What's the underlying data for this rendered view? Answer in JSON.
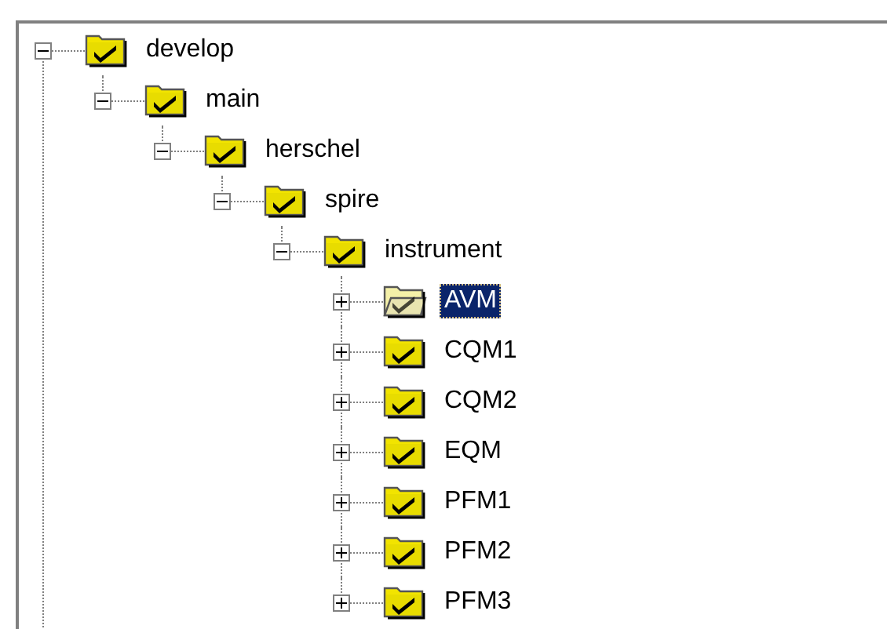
{
  "tree": [
    {
      "label": "develop",
      "expanded": true,
      "selected": false,
      "children": [
        {
          "label": "main",
          "expanded": true,
          "selected": false,
          "children": [
            {
              "label": "herschel",
              "expanded": true,
              "selected": false,
              "children": [
                {
                  "label": "spire",
                  "expanded": true,
                  "selected": false,
                  "children": [
                    {
                      "label": "instrument",
                      "expanded": true,
                      "selected": false,
                      "children": [
                        {
                          "label": "AVM",
                          "expanded": false,
                          "selected": true
                        },
                        {
                          "label": "CQM1",
                          "expanded": false,
                          "selected": false
                        },
                        {
                          "label": "CQM2",
                          "expanded": false,
                          "selected": false
                        },
                        {
                          "label": "EQM",
                          "expanded": false,
                          "selected": false
                        },
                        {
                          "label": "PFM1",
                          "expanded": false,
                          "selected": false
                        },
                        {
                          "label": "PFM2",
                          "expanded": false,
                          "selected": false
                        },
                        {
                          "label": "PFM3",
                          "expanded": false,
                          "selected": false
                        }
                      ]
                    }
                  ]
                }
              ]
            }
          ]
        }
      ]
    }
  ]
}
